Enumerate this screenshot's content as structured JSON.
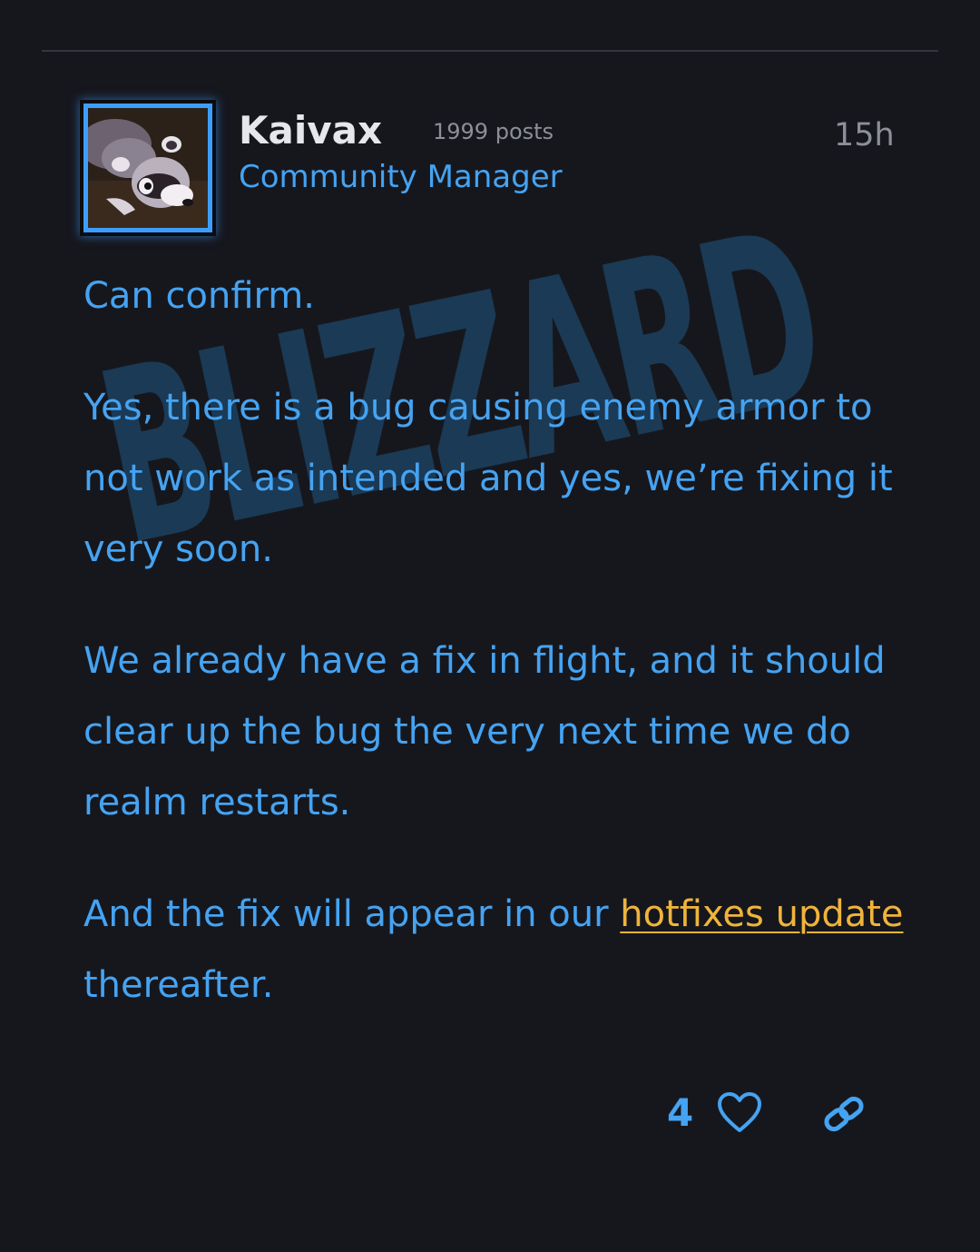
{
  "post": {
    "author": {
      "username": "Kaivax",
      "post_count": "1999 posts",
      "role": "Community Manager",
      "avatar": "raccoon-avatar"
    },
    "timestamp": "15h",
    "watermark_text": "BLIZZARD",
    "paragraphs": [
      "Can confirm.",
      "Yes, there is a bug causing enemy armor to not work as intended and yes, we’re fixing it very soon.",
      "We already have a fix in flight, and it should clear up the bug the very next time we do realm restarts."
    ],
    "last_paragraph": {
      "before_link": "And the fix will appear in our ",
      "link_text": "hotfixes update",
      "after_link": " thereafter."
    },
    "actions": {
      "like_count": "4",
      "like_icon": "heart-outline-icon",
      "share_icon": "link-icon"
    }
  },
  "colors": {
    "background": "#16171d",
    "accent_blue": "#45a3f2",
    "link_gold": "#f0b43a",
    "muted_text": "#8d8f98",
    "username": "#e6e7ec",
    "watermark": "#1b3a55"
  }
}
